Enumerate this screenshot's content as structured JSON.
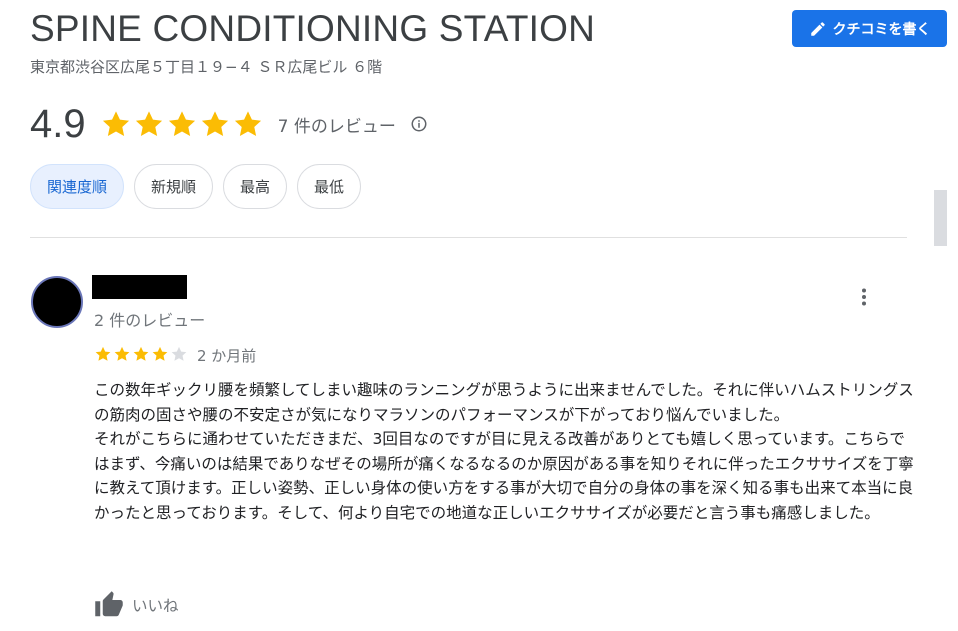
{
  "place": {
    "name": "SPINE CONDITIONING STATION",
    "address": "東京都渋谷区広尾５丁目１９−４ ＳＲ広尾ビル ６階"
  },
  "write_review_button": {
    "label": "クチコミを書く",
    "icon": "pencil-icon"
  },
  "rating": {
    "score": "4.9",
    "stars": 5,
    "count_text": "7 件のレビュー",
    "star_color": "#fbbc04",
    "info_icon": "info-icon"
  },
  "sort_chips": [
    {
      "label": "関連度順",
      "active": true
    },
    {
      "label": "新規順",
      "active": false
    },
    {
      "label": "最高",
      "active": false
    },
    {
      "label": "最低",
      "active": false
    }
  ],
  "review": {
    "reviewer_review_count": "2 件のレビュー",
    "rating": 4,
    "max_rating": 5,
    "date": "2 か月前",
    "paragraph1": "この数年ギックリ腰を頻繁してしまい趣味のランニングが思うように出来ませんでした。それに伴いハムストリングスの筋肉の固さや腰の不安定さが気になりマラソンのパフォーマンスが下がっており悩んでいました。",
    "paragraph2": "それがこちらに通わせていただきまだ、3回目なのですが目に見える改善がありとても嬉しく思っています。こちらではまず、今痛いのは結果でありなぜその場所が痛くなるなるのか原因がある事を知りそれに伴ったエクササイズを丁寧に教えて頂けます。正しい姿勢、正しい身体の使い方をする事が大切で自分の身体の事を深く知る事も出来て本当に良かったと思っております。そして、何より自宅での地道な正しいエクササイズが必要だと言う事も痛感しました。",
    "like_label": "いいね",
    "like_icon": "thumbs-up-icon",
    "more_icon": "more-vert-icon"
  },
  "colors": {
    "accent": "#1a73e8",
    "chip_active_bg": "#e8f0fe",
    "chip_active_text": "#1967d2",
    "star_empty": "#dadce0"
  }
}
